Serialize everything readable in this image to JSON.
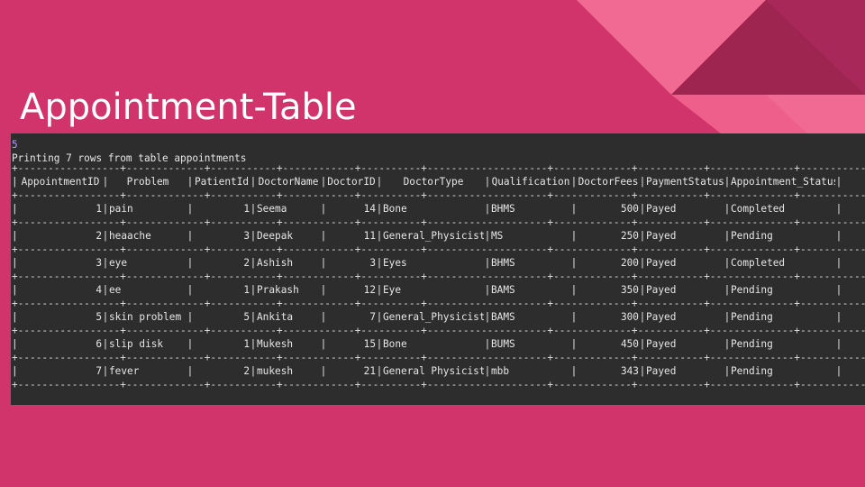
{
  "slide": {
    "title": "Appointment-Table",
    "colors": {
      "background": "#d1346b",
      "accent_dark": "#9e2550",
      "accent_light": "#f06a94",
      "terminal_bg": "#2d2d2d"
    }
  },
  "terminal": {
    "prompt_line": "5",
    "message": "Printing 7 rows from table appointments",
    "border_line": "+-----------------+-------------+-----------+------------+----------+--------------------+-------------+-----------+--------------+--------------------+",
    "columns": [
      "AppointmentID",
      "Problem",
      "PatientId",
      "DoctorName",
      "DoctorID",
      "DoctorType",
      "Qualification",
      "DoctorFees",
      "PaymentStatus",
      "Appointment_Status"
    ],
    "rows": [
      [
        "1",
        "pain",
        "1",
        "Seema",
        "14",
        "Bone",
        "BHMS",
        "500",
        "Payed",
        "Completed"
      ],
      [
        "2",
        "heaache",
        "3",
        "Deepak",
        "11",
        "General_Physicist",
        "MS",
        "250",
        "Payed",
        "Pending"
      ],
      [
        "3",
        "eye",
        "2",
        "Ashish",
        "3",
        "Eyes",
        "BHMS",
        "200",
        "Payed",
        "Completed"
      ],
      [
        "4",
        "ee",
        "1",
        "Prakash",
        "12",
        "Eye",
        "BAMS",
        "350",
        "Payed",
        "Pending"
      ],
      [
        "5",
        "skin problem",
        "5",
        "Ankita",
        "7",
        "General_Physicist",
        "BAMS",
        "300",
        "Payed",
        "Pending"
      ],
      [
        "6",
        "slip disk",
        "1",
        "Mukesh",
        "15",
        "Bone",
        "BUMS",
        "450",
        "Payed",
        "Pending"
      ],
      [
        "7",
        "fever",
        "2",
        "mukesh",
        "21",
        "General Physicist",
        "mbb",
        "343",
        "Payed",
        "Pending"
      ]
    ]
  }
}
